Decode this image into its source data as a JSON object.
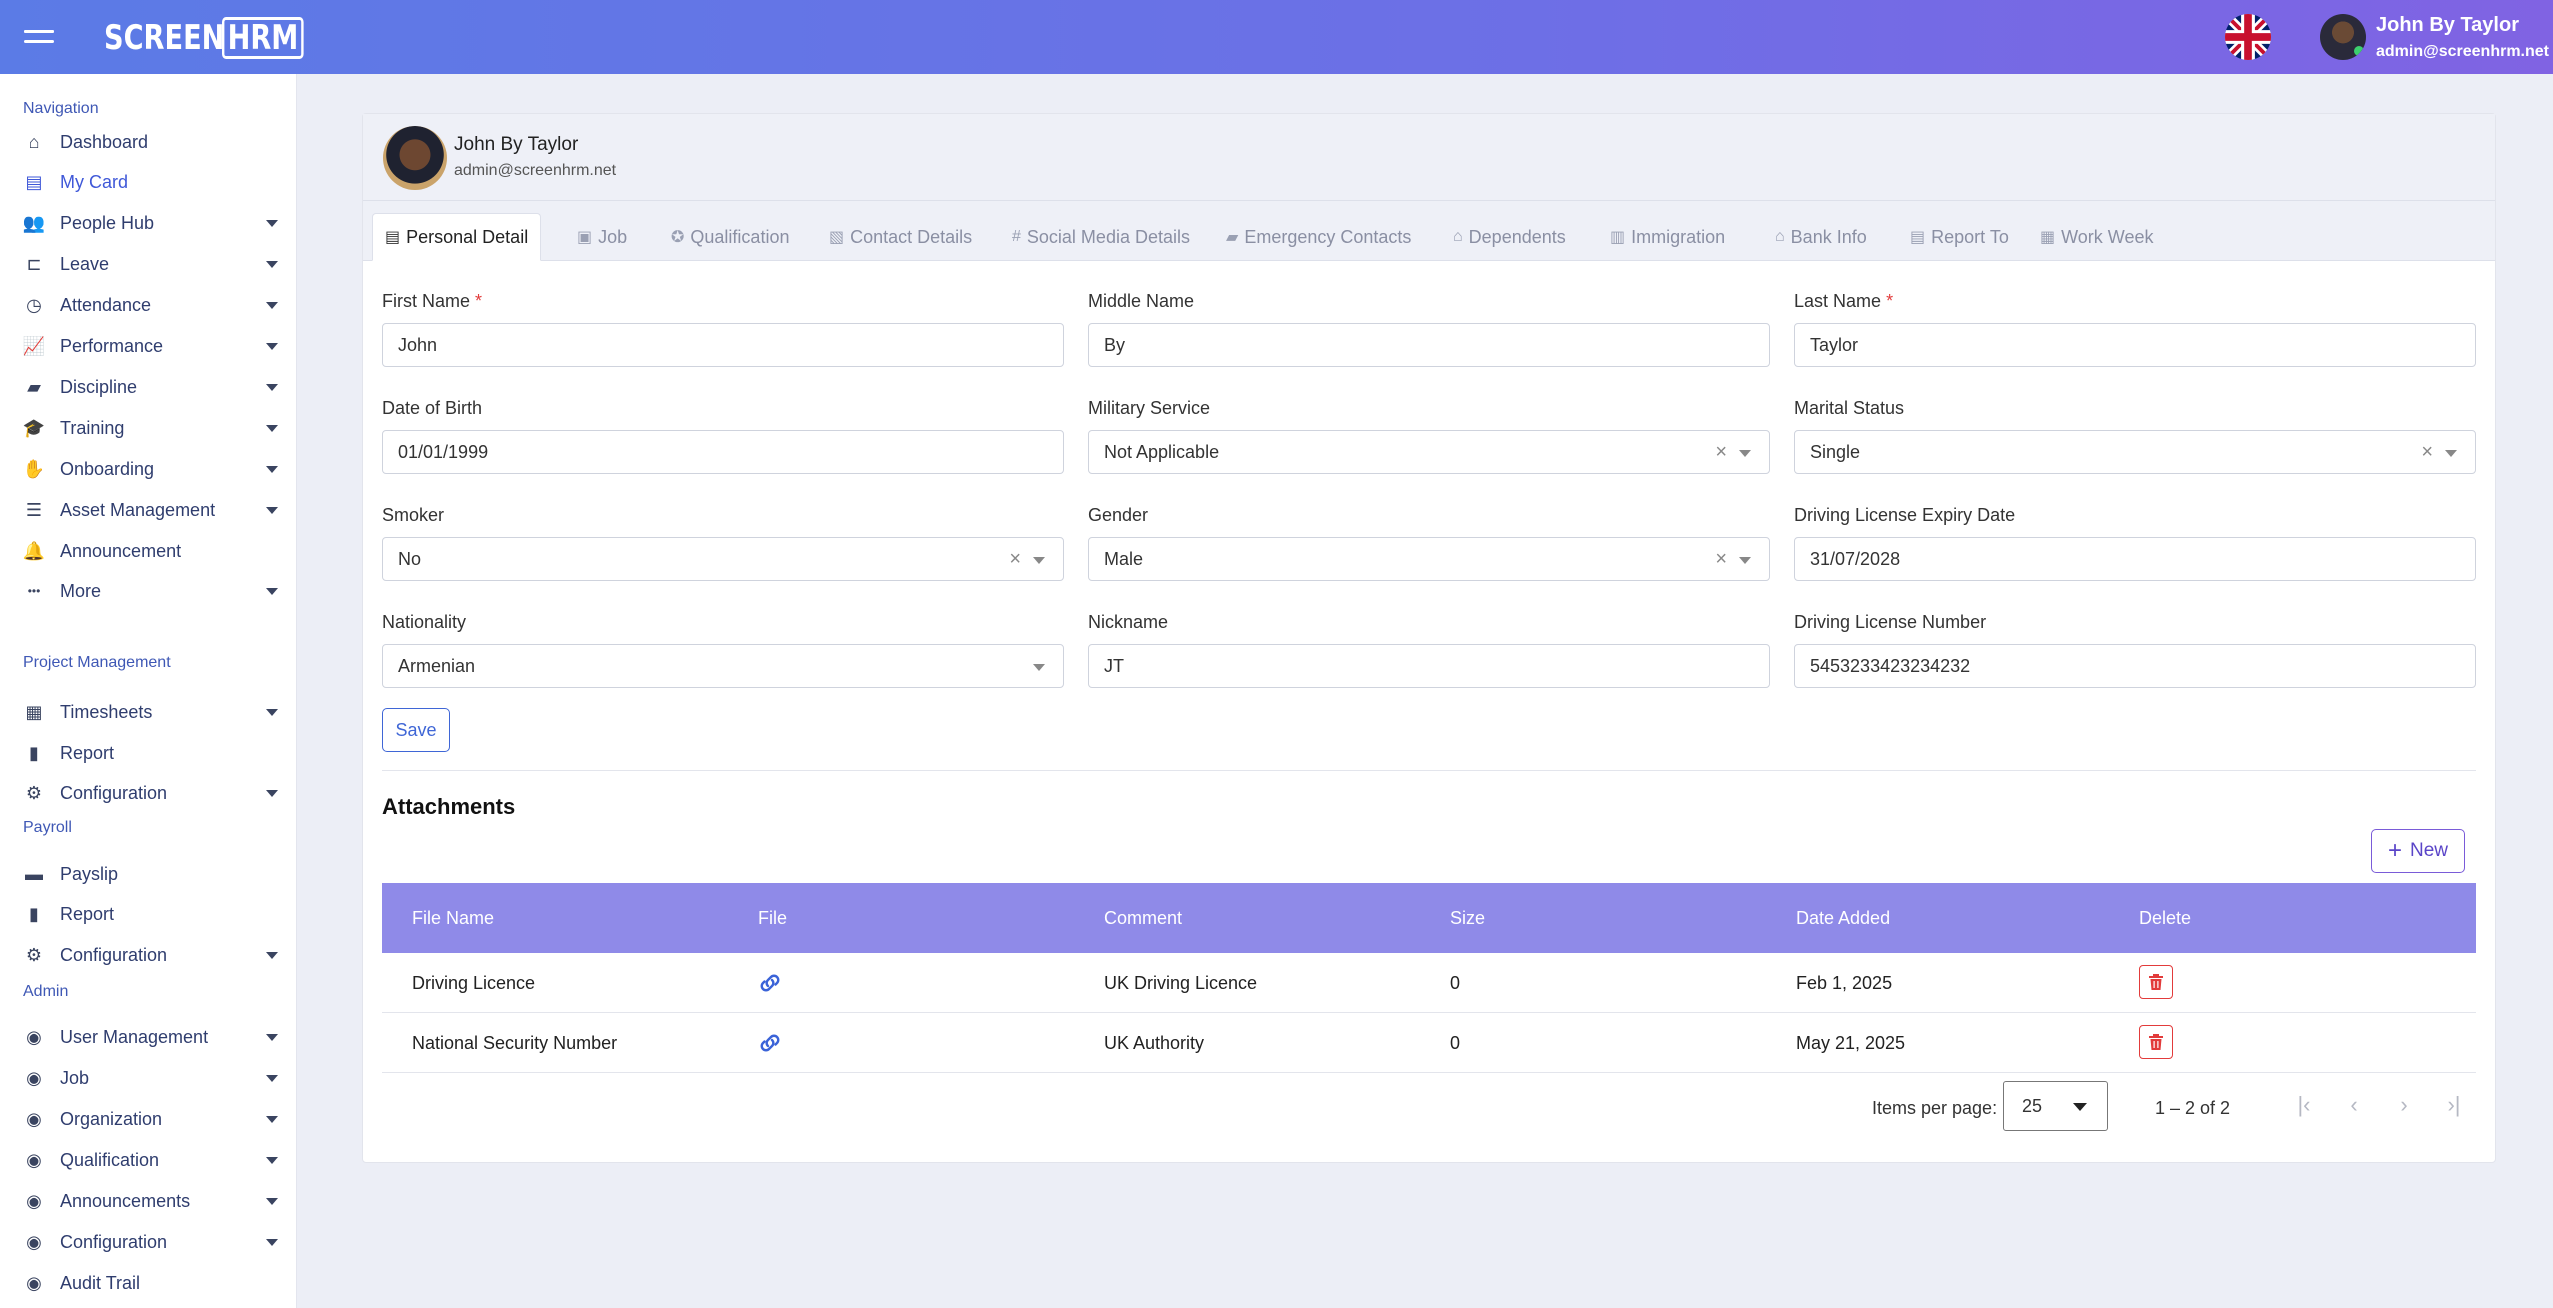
{
  "header": {
    "logo_left": "SCREEN",
    "logo_right": "HRM",
    "user_name": "John By Taylor",
    "user_email": "admin@screenhrm.net"
  },
  "sidebar": {
    "sections": {
      "navigation": "Navigation",
      "project": "Project Management",
      "payroll": "Payroll",
      "admin": "Admin"
    },
    "items": [
      {
        "label": "Dashboard",
        "icon": "home-icon",
        "chevron": false,
        "active": false
      },
      {
        "label": "My Card",
        "icon": "id-card-icon",
        "chevron": false,
        "active": true
      },
      {
        "label": "People Hub",
        "icon": "users-icon",
        "chevron": true,
        "active": false
      },
      {
        "label": "Leave",
        "icon": "door-icon",
        "chevron": true,
        "active": false
      },
      {
        "label": "Attendance",
        "icon": "clock-icon",
        "chevron": true,
        "active": false
      },
      {
        "label": "Performance",
        "icon": "line-chart-icon",
        "chevron": true,
        "active": false
      },
      {
        "label": "Discipline",
        "icon": "folder-icon",
        "chevron": true,
        "active": false
      },
      {
        "label": "Training",
        "icon": "graduation-cap-icon",
        "chevron": true,
        "active": false
      },
      {
        "label": "Onboarding",
        "icon": "handshake-icon",
        "chevron": true,
        "active": false
      },
      {
        "label": "Asset Management",
        "icon": "list-check-icon",
        "chevron": true,
        "active": false
      },
      {
        "label": "Announcement",
        "icon": "bell-icon",
        "chevron": false,
        "active": false
      },
      {
        "label": "More",
        "icon": "ellipsis-icon",
        "chevron": true,
        "active": false
      },
      {
        "label": "Timesheets",
        "icon": "calendar-check-icon",
        "chevron": true,
        "active": false
      },
      {
        "label": "Report",
        "icon": "bar-chart-icon",
        "chevron": false,
        "active": false
      },
      {
        "label": "Configuration",
        "icon": "gear-icon",
        "chevron": true,
        "active": false
      },
      {
        "label": "Payslip",
        "icon": "wallet-icon",
        "chevron": false,
        "active": false
      },
      {
        "label": "Report",
        "icon": "bar-chart-icon",
        "chevron": false,
        "active": false
      },
      {
        "label": "Configuration",
        "icon": "gear-icon",
        "chevron": true,
        "active": false
      },
      {
        "label": "User Management",
        "icon": "circle-icon",
        "chevron": true,
        "active": false
      },
      {
        "label": "Job",
        "icon": "circle-icon",
        "chevron": true,
        "active": false
      },
      {
        "label": "Organization",
        "icon": "circle-icon",
        "chevron": true,
        "active": false
      },
      {
        "label": "Qualification",
        "icon": "circle-icon",
        "chevron": true,
        "active": false
      },
      {
        "label": "Announcements",
        "icon": "circle-icon",
        "chevron": true,
        "active": false
      },
      {
        "label": "Configuration",
        "icon": "circle-icon",
        "chevron": true,
        "active": false
      },
      {
        "label": "Audit Trail",
        "icon": "circle-icon",
        "chevron": false,
        "active": false
      }
    ]
  },
  "profile": {
    "name": "John By Taylor",
    "email": "admin@screenhrm.net"
  },
  "tabs": [
    {
      "label": "Personal Detail",
      "icon": "id-card-icon",
      "active": true
    },
    {
      "label": "Job",
      "icon": "briefcase-icon",
      "active": false
    },
    {
      "label": "Qualification",
      "icon": "medal-icon",
      "active": false
    },
    {
      "label": "Contact Details",
      "icon": "contact-icon",
      "active": false
    },
    {
      "label": "Social Media Details",
      "icon": "hash-icon",
      "active": false
    },
    {
      "label": "Emergency Contacts",
      "icon": "truck-icon",
      "active": false
    },
    {
      "label": "Dependents",
      "icon": "people-roof-icon",
      "active": false
    },
    {
      "label": "Immigration",
      "icon": "passport-icon",
      "active": false
    },
    {
      "label": "Bank Info",
      "icon": "bank-icon",
      "active": false
    },
    {
      "label": "Report To",
      "icon": "report-icon",
      "active": false
    },
    {
      "label": "Work Week",
      "icon": "calendar-icon",
      "active": false
    }
  ],
  "form": {
    "first_name": {
      "label": "First Name",
      "required": "*",
      "value": "John"
    },
    "middle_name": {
      "label": "Middle Name",
      "value": "By"
    },
    "last_name": {
      "label": "Last Name",
      "required": "*",
      "value": "Taylor"
    },
    "dob": {
      "label": "Date of Birth",
      "value": "01/01/1999"
    },
    "military": {
      "label": "Military Service",
      "value": "Not Applicable"
    },
    "marital": {
      "label": "Marital Status",
      "value": "Single"
    },
    "smoker": {
      "label": "Smoker",
      "value": "No"
    },
    "gender": {
      "label": "Gender",
      "value": "Male"
    },
    "dl_expiry": {
      "label": "Driving License Expiry Date",
      "value": "31/07/2028"
    },
    "nationality": {
      "label": "Nationality",
      "value": "Armenian"
    },
    "nickname": {
      "label": "Nickname",
      "value": "JT"
    },
    "dl_number": {
      "label": "Driving License Number",
      "value": "5453233423234232"
    },
    "save_label": "Save"
  },
  "attachments": {
    "title": "Attachments",
    "new_label": "New",
    "columns": [
      "File Name",
      "File",
      "Comment",
      "Size",
      "Date Added",
      "Delete"
    ],
    "rows": [
      {
        "file_name": "Driving Licence",
        "comment": "UK Driving Licence",
        "size": "0",
        "date": "Feb 1, 2025"
      },
      {
        "file_name": "National Security Number",
        "comment": "UK Authority",
        "size": "0",
        "date": "May 21, 2025"
      }
    ]
  },
  "pager": {
    "items_label": "Items per page:",
    "page_size": "25",
    "range": "1 – 2 of 2"
  }
}
